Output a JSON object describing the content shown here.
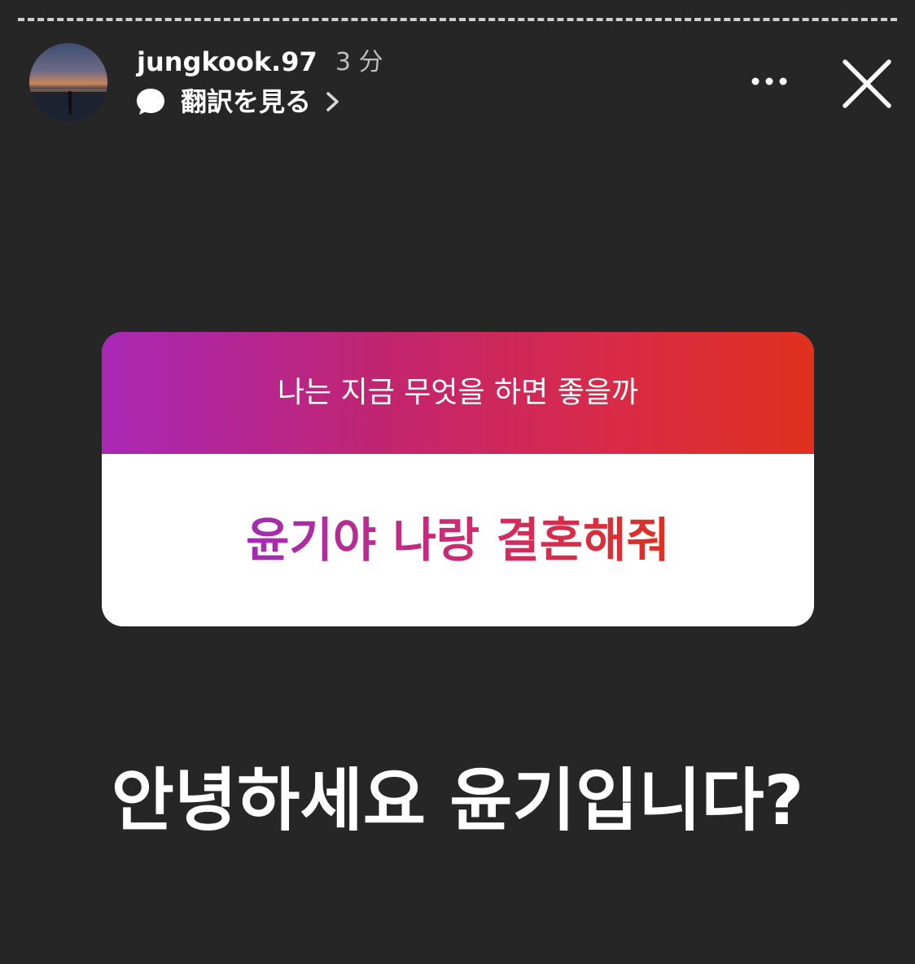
{
  "story_header": {
    "username": "jungkook.97",
    "time_ago": "3 分",
    "translate_label": "翻訳を見る"
  },
  "icons": {
    "translate": "speech-bubble-icon",
    "chevron": "chevron-right-icon",
    "more": "more-horizontal-icon",
    "close": "close-icon"
  },
  "question_sticker": {
    "question": "나는 지금 무엇을 하면 좋을까",
    "answer": "윤기야 나랑 결혼해줘",
    "colors": {
      "gradient_start": "#a827b5",
      "gradient_mid": "#c2256f",
      "gradient_end": "#e0301e"
    }
  },
  "reply_text": "안녕하세요 윤기입니다?",
  "colors": {
    "background": "#262626",
    "text": "#ffffff",
    "muted_text": "#bdbdbd"
  }
}
